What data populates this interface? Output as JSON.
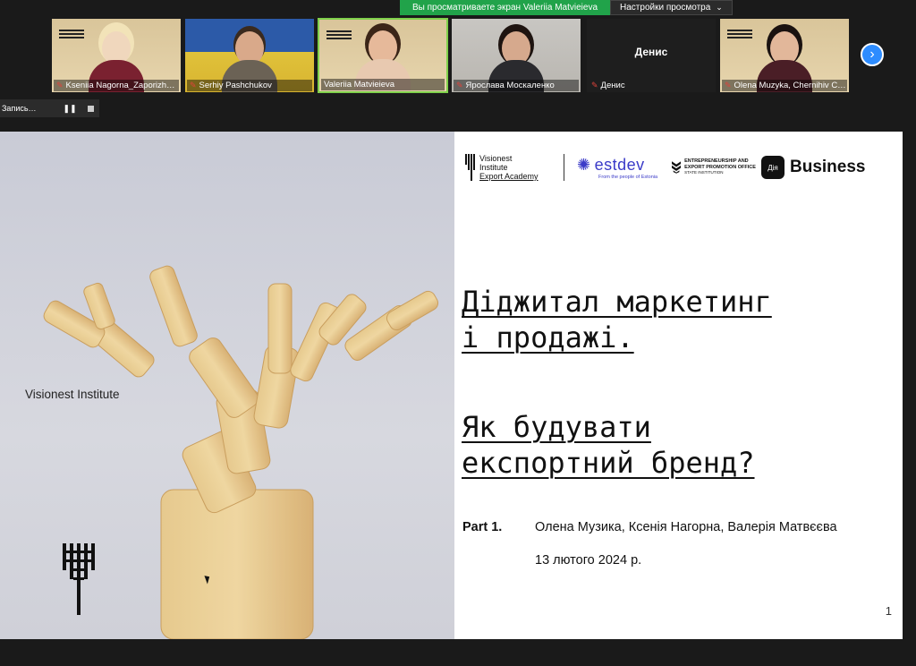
{
  "share_banner": {
    "viewing_text": "Вы просматриваете экран Valeriia Matvieieva",
    "options_label": "Настройки просмотра",
    "viewing_color": "#21a34a"
  },
  "participants": [
    {
      "name": "Kseniia Nagorna_Zaporizh…",
      "muted": true
    },
    {
      "name": "Serhiy Pashchukov",
      "muted": true
    },
    {
      "name": "Valeriia Matvieieva",
      "muted": false,
      "active": true
    },
    {
      "name": "Ярослава Москаленко",
      "muted": true
    },
    {
      "name": "Денис",
      "display_name": "Денис",
      "muted": true,
      "video_off": true
    },
    {
      "name": "Olena Muzyka, Chernihiv C…",
      "muted": true
    }
  ],
  "next_icon": "chevron-right-icon",
  "recording": {
    "label": "Запись…"
  },
  "slide": {
    "left_label": "Visionest Institute",
    "logos": {
      "vi_line1": "Visionest",
      "vi_line2": "Institute",
      "vi_line3": "Export Academy",
      "estdev": "ESTDEV",
      "estdev_sub": "From the people of Estonia",
      "eepo": "ENTREPRENEURSHIP AND EXPORT PROMOTION OFFICE",
      "eepo_sub": "STATE INSTITUTION",
      "diia_box": "Дія",
      "diia_business": "Business"
    },
    "title_line1": "Діджитал маркетинг",
    "title_line2": "і продажі.",
    "subtitle_line1": "Як будувати",
    "subtitle_line2": "експортний бренд?",
    "part": "Part 1.",
    "authors": "Олена Музика, Ксенія Нагорна, Валерія Матвєєва",
    "date": "13 лютого 2024 р.",
    "page_number": "1"
  }
}
